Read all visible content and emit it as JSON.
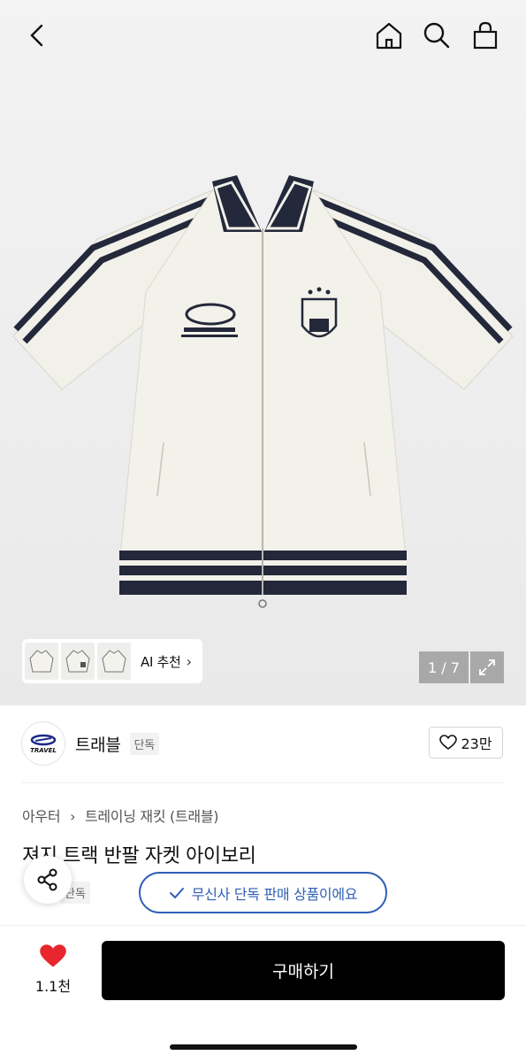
{
  "header": {
    "back_icon": "chevron-left-icon",
    "icons": [
      "home-icon",
      "search-icon",
      "shopping-bag-icon"
    ]
  },
  "gallery": {
    "ai_label": "AI 추천",
    "counter": "1 / 7"
  },
  "brand": {
    "logo_text": "TRAVEL",
    "name": "트래블",
    "badge": "단독",
    "likes": "23만"
  },
  "product": {
    "breadcrumb": [
      "아우터",
      "트레이닝 재킷 (트래블)"
    ],
    "title": "져지 트랙 반팔 자켓 아이보리",
    "badge": "단독",
    "exclusive_notice": "무신사 단독 판매 상품이에요"
  },
  "footer": {
    "like_count": "1.1천",
    "buy_label": "구매하기"
  },
  "colors": {
    "accent_blue": "#2f5fb5",
    "like_red": "#e8262d",
    "buy_bg": "#000000"
  }
}
